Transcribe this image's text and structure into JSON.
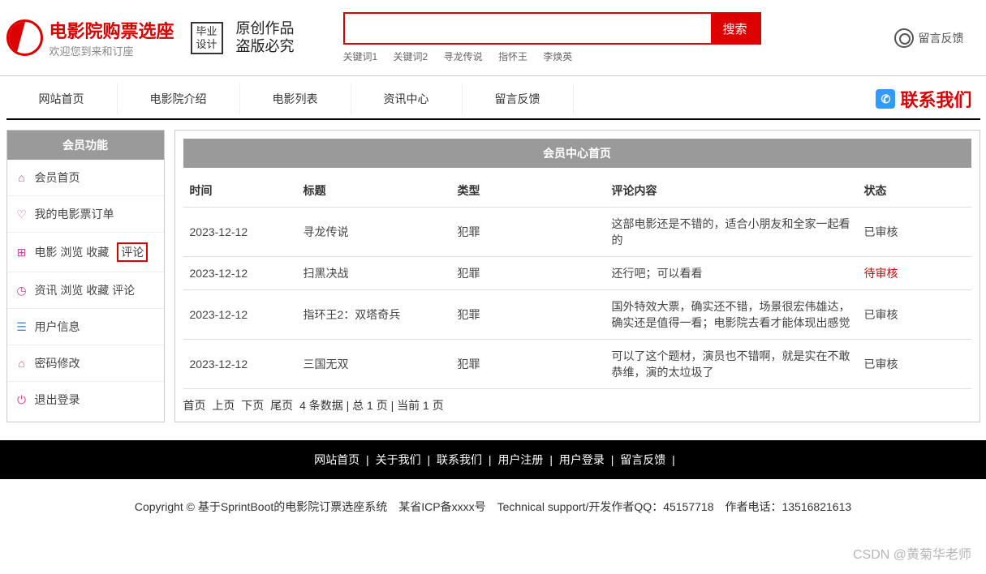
{
  "header": {
    "site_name": "电影院购票选座",
    "slogan": "欢迎您到来和订座",
    "stamp_line1": "毕业",
    "stamp_line2": "设计",
    "brush_line1": "原创作品",
    "brush_line2": "盗版必究",
    "search_placeholder": "",
    "search_btn": "搜索",
    "keywords": [
      "关键词1",
      "关键词2",
      "寻龙传说",
      "指怀王",
      "李焕英"
    ],
    "feedback": "留言反馈"
  },
  "nav": {
    "items": [
      "网站首页",
      "电影院介绍",
      "电影列表",
      "资讯中心",
      "留言反馈"
    ],
    "contact": "联系我们"
  },
  "sidebar": {
    "header": "会员功能",
    "items": [
      {
        "icon": "⌂",
        "label": "会员首页"
      },
      {
        "icon": "♡",
        "label": "我的电影票订单"
      },
      {
        "icon": "⊞",
        "label_prefix": "电影 浏览 收藏 ",
        "label_highlight": "评论"
      },
      {
        "icon": "◷",
        "label": "资讯 浏览 收藏 评论"
      },
      {
        "icon": "☰",
        "label": "用户信息"
      },
      {
        "icon": "⌂",
        "label": "密码修改",
        "icon_alt": "lock"
      },
      {
        "icon": "⏻",
        "label": "退出登录"
      }
    ]
  },
  "main": {
    "panel_title": "会员中心首页",
    "columns": [
      "时间",
      "标题",
      "类型",
      "评论内容",
      "状态"
    ],
    "rows": [
      {
        "time": "2023-12-12",
        "title": "寻龙传说",
        "type": "犯罪",
        "content": "这部电影还是不错的，适合小朋友和全家一起看的",
        "status": "已审核"
      },
      {
        "time": "2023-12-12",
        "title": "扫黑决战",
        "type": "犯罪",
        "content": "还行吧；可以看看",
        "status": "待审核",
        "pending": true
      },
      {
        "time": "2023-12-12",
        "title": "指环王2：双塔奇兵",
        "type": "犯罪",
        "content": "国外特效大票，确实还不错，场景很宏伟雄达，确实还是值得一看；电影院去看才能体现出感觉",
        "status": "已审核"
      },
      {
        "time": "2023-12-12",
        "title": "三国无双",
        "type": "犯罪",
        "content": "可以了这个题材，演员也不错啊，就是实在不敢恭维，演的太垃圾了",
        "status": "已审核"
      }
    ],
    "pagination": {
      "links": [
        "首页",
        "上页",
        "下页",
        "尾页"
      ],
      "info": "4 条数据 | 总 1 页 | 当前 1 页"
    }
  },
  "footer": {
    "links": [
      "网站首页",
      "关于我们",
      "联系我们",
      "用户注册",
      "用户登录",
      "留言反馈"
    ],
    "copyright": "Copyright © 基于SprintBoot的电影院订票选座系统　某省ICP备xxxx号　Technical support/开发作者QQ：45157718　作者电话：13516821613"
  },
  "watermark": "CSDN @黄菊华老师"
}
